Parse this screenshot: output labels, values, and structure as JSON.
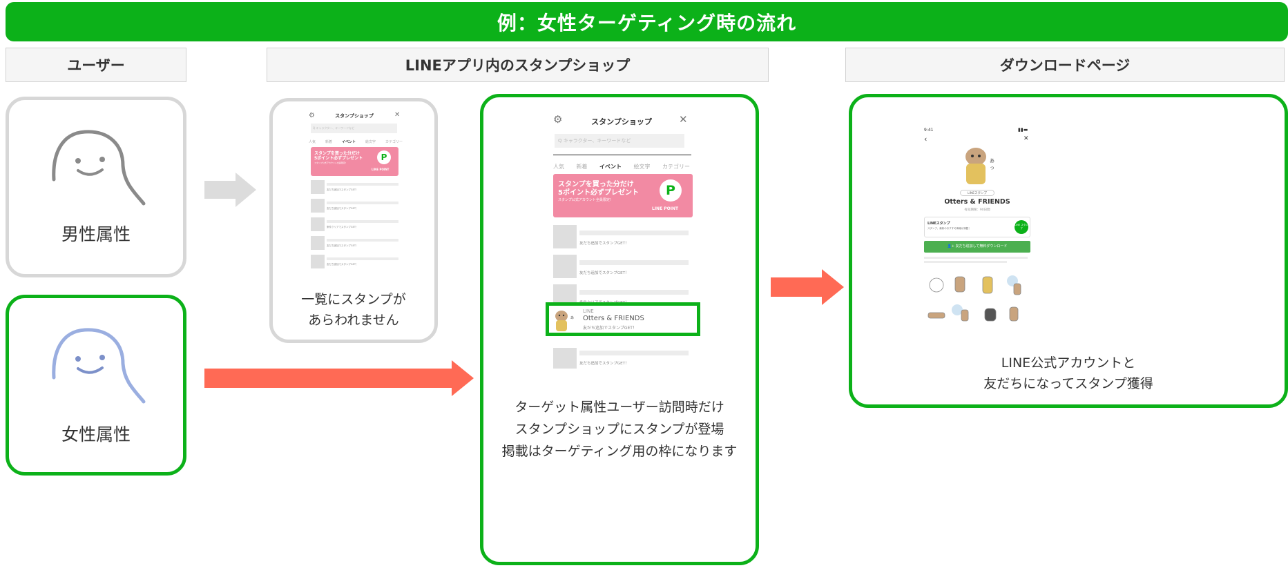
{
  "banner": {
    "title": "例：女性ターゲティング時の流れ"
  },
  "headers": {
    "user": "ユーザー",
    "shop": "LINEアプリ内のスタンプショップ",
    "download": "ダウンロードページ"
  },
  "users": {
    "male_label": "男性属性",
    "female_label": "女性属性"
  },
  "shop_small": {
    "title": "スタンプショップ",
    "search_placeholder": "Q キャラクター、キーワードなど",
    "tabs": [
      "人気",
      "新着",
      "イベント",
      "絵文字",
      "カテゴリー"
    ],
    "promo_line1": "スタンプを買った分だけ",
    "promo_line2": "5ポイント必ずプレゼント",
    "promo_line3": "スタンプ公式アカウント全員限定!",
    "point_letter": "P",
    "point_label": "LINE POINT",
    "rows": [
      "友だち追加でスタンプGET！",
      "友だち追加でスタンプGET！",
      "条件クリアでスタンプGET！",
      "友だち追加でスタンプGET！",
      "友だち追加でスタンプGET！"
    ],
    "caption_line1": "一覧にスタンプが",
    "caption_line2": "あらわれません"
  },
  "shop_large": {
    "title": "スタンプショップ",
    "search_placeholder": "Q キャラクター、キーワードなど",
    "tabs": [
      "人気",
      "新着",
      "イベント",
      "絵文字",
      "カテゴリー"
    ],
    "promo_line1": "スタンプを買った分だけ",
    "promo_line2": "5ポイント必ずプレゼント",
    "promo_line3": "スタンプ公式アカウント全員限定!",
    "point_letter": "P",
    "point_label": "LINE POINT",
    "rows": [
      "友だち追加でスタンプGET！",
      "友だち追加でスタンプGET！",
      "条件クリアでスタンプGET！"
    ],
    "highlight_brand": "LINE",
    "highlight_name": "Otters & FRIENDS",
    "highlight_sub": "友だち追加でスタンプGET！",
    "last_row": "友だち追加でスタンプGET！",
    "caption_line1": "ターゲット属性ユーザー訪問時だけ",
    "caption_line2": "スタンプショップにスタンプが登場",
    "caption_line3": "掲載はターゲティング用の枠になります"
  },
  "download": {
    "time": "9:41",
    "badge": "LINEスタンプ",
    "name": "Otters & FRIENDS",
    "period": "有効期限：90日間",
    "info_title": "LINEスタンプ",
    "info_sub": "スタンプ、最新のおすすめ情報が満載！",
    "info_icon": "LINE スタンプ",
    "cta": "友だち追加して無料ダウンロード",
    "caption_line1": "LINE公式アカウントと",
    "caption_line2": "友だちになってスタンプ獲得"
  },
  "colors": {
    "green": "#0cb119",
    "gray_border": "#d7d7d7",
    "arrow_red": "#ff6a55",
    "arrow_gray": "#dcdcdc",
    "pink": "#f28aa3"
  }
}
